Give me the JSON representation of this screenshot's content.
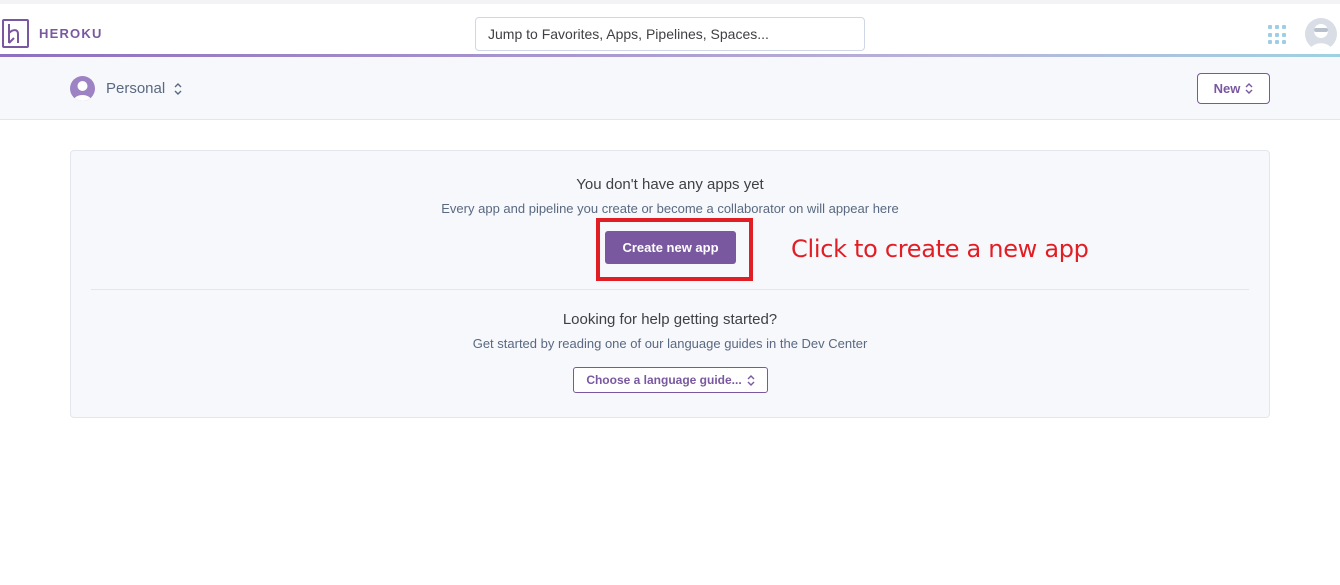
{
  "header": {
    "brand": "HEROKU",
    "search_placeholder": "Jump to Favorites, Apps, Pipelines, Spaces..."
  },
  "subbar": {
    "account_label": "Personal",
    "new_label": "New"
  },
  "empty_state": {
    "title": "You don't have any apps yet",
    "subtitle": "Every app and pipeline you create or become a collaborator on will appear here",
    "create_label": "Create new app"
  },
  "help": {
    "title": "Looking for help getting started?",
    "subtitle": "Get started by reading one of our language guides in the Dev Center",
    "guide_label": "Choose a language guide..."
  },
  "annotation": {
    "text": "Click to create a new app"
  },
  "colors": {
    "brand": "#79589f",
    "annotation": "#e21e25"
  },
  "icons": [
    "heroku-logo-icon",
    "apps-grid-icon",
    "user-avatar-icon",
    "personal-avatar-icon",
    "chevron-updown-icon"
  ]
}
